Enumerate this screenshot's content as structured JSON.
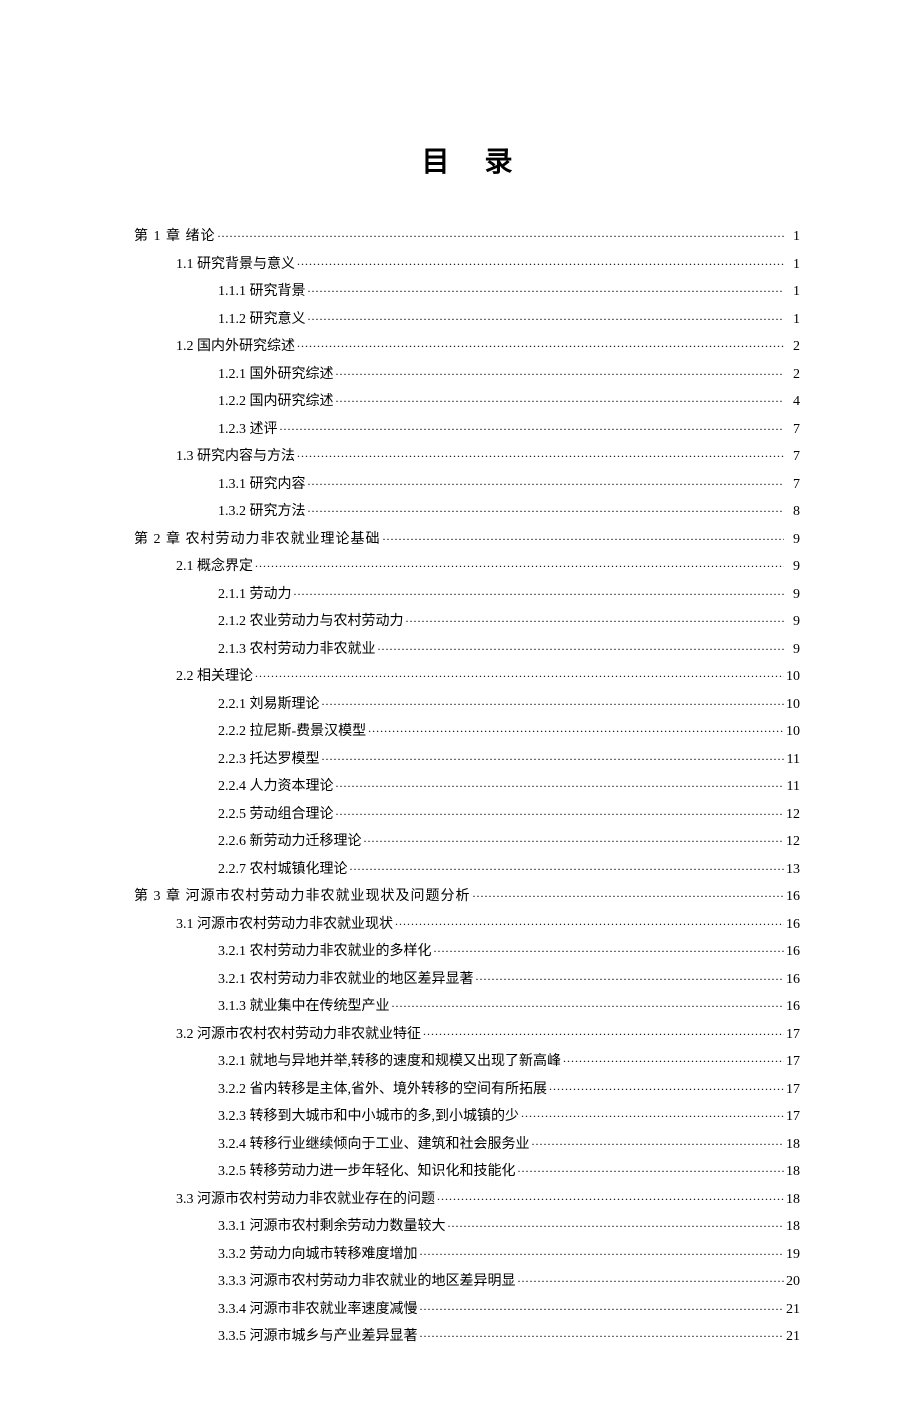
{
  "title": "目 录",
  "toc": [
    {
      "level": 1,
      "label": "第 1 章   绪论",
      "page": "1"
    },
    {
      "level": 2,
      "label": "1.1 研究背景与意义",
      "page": "1"
    },
    {
      "level": 3,
      "label": "1.1.1 研究背景",
      "page": "1"
    },
    {
      "level": 3,
      "label": "1.1.2 研究意义",
      "page": "1"
    },
    {
      "level": 2,
      "label": "1.2 国内外研究综述",
      "page": "2"
    },
    {
      "level": 3,
      "label": "1.2.1 国外研究综述",
      "page": "2"
    },
    {
      "level": 3,
      "label": "1.2.2 国内研究综述",
      "page": "4"
    },
    {
      "level": 3,
      "label": "1.2.3 述评",
      "page": "7"
    },
    {
      "level": 2,
      "label": "1.3 研究内容与方法",
      "page": "7"
    },
    {
      "level": 3,
      "label": "1.3.1 研究内容",
      "page": "7"
    },
    {
      "level": 3,
      "label": "1.3.2 研究方法",
      "page": "8"
    },
    {
      "level": 1,
      "label": "第 2 章   农村劳动力非农就业理论基础",
      "page": "9"
    },
    {
      "level": 2,
      "label": "2.1 概念界定",
      "page": "9"
    },
    {
      "level": 3,
      "label": "2.1.1 劳动力",
      "page": "9"
    },
    {
      "level": 3,
      "label": "2.1.2 农业劳动力与农村劳动力",
      "page": "9"
    },
    {
      "level": 3,
      "label": "2.1.3 农村劳动力非农就业",
      "page": "9"
    },
    {
      "level": 2,
      "label": "2.2 相关理论",
      "page": "10"
    },
    {
      "level": 3,
      "label": "2.2.1 刘易斯理论",
      "page": "10"
    },
    {
      "level": 3,
      "label": "2.2.2 拉尼斯-费景汉模型",
      "page": "10"
    },
    {
      "level": 3,
      "label": "2.2.3 托达罗模型",
      "page": "11"
    },
    {
      "level": 3,
      "label": "2.2.4 人力资本理论",
      "page": "11"
    },
    {
      "level": 3,
      "label": "2.2.5 劳动组合理论",
      "page": "12"
    },
    {
      "level": 3,
      "label": "2.2.6 新劳动力迁移理论",
      "page": "12"
    },
    {
      "level": 3,
      "label": "2.2.7 农村城镇化理论",
      "page": "13"
    },
    {
      "level": 1,
      "label": "第 3 章   河源市农村劳动力非农就业现状及问题分析",
      "page": "16"
    },
    {
      "level": 2,
      "label": "3.1 河源市农村劳动力非农就业现状",
      "page": "16"
    },
    {
      "level": 3,
      "label": "3.2.1 农村劳动力非农就业的多样化",
      "page": "16"
    },
    {
      "level": 3,
      "label": "3.2.1 农村劳动力非农就业的地区差异显著",
      "page": "16"
    },
    {
      "level": 3,
      "label": "3.1.3 就业集中在传统型产业",
      "page": "16"
    },
    {
      "level": 2,
      "label": "3.2 河源市农村农村劳动力非农就业特征",
      "page": "17"
    },
    {
      "level": 3,
      "label": "3.2.1 就地与异地并举,转移的速度和规模又出现了新高峰",
      "page": "17"
    },
    {
      "level": 3,
      "label": "3.2.2 省内转移是主体,省外、境外转移的空间有所拓展",
      "page": "17"
    },
    {
      "level": 3,
      "label": "3.2.3 转移到大城市和中小城市的多,到小城镇的少",
      "page": "17"
    },
    {
      "level": 3,
      "label": "3.2.4 转移行业继续倾向于工业、建筑和社会服务业",
      "page": "18"
    },
    {
      "level": 3,
      "label": "3.2.5 转移劳动力进一步年轻化、知识化和技能化",
      "page": "18"
    },
    {
      "level": 2,
      "label": "3.3 河源市农村劳动力非农就业存在的问题",
      "page": "18"
    },
    {
      "level": 3,
      "label": "3.3.1 河源市农村剩余劳动力数量较大",
      "page": "18"
    },
    {
      "level": 3,
      "label": "3.3.2 劳动力向城市转移难度增加",
      "page": "19"
    },
    {
      "level": 3,
      "label": "3.3.3 河源市农村劳动力非农就业的地区差异明显",
      "page": "20"
    },
    {
      "level": 3,
      "label": "3.3.4 河源市非农就业率速度减慢",
      "page": "21"
    },
    {
      "level": 3,
      "label": "3.3.5 河源市城乡与产业差异显著",
      "page": "21"
    }
  ]
}
